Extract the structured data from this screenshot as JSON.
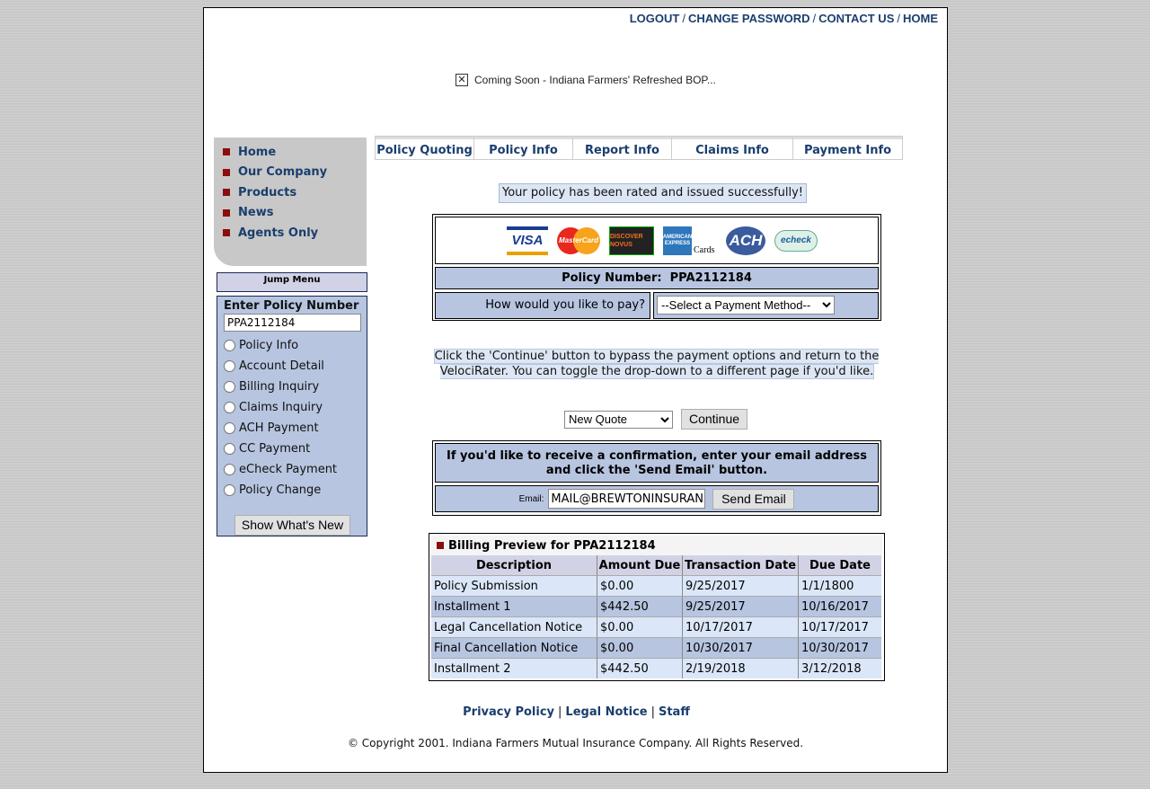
{
  "header": {
    "links": [
      "LOGOUT",
      "CHANGE PASSWORD",
      "CONTACT US",
      "HOME"
    ],
    "banner_text": "Coming Soon - Indiana Farmers' Refreshed BOP..."
  },
  "sidebar": {
    "items": [
      "Home",
      "Our Company",
      "Products",
      "News",
      "Agents Only"
    ],
    "jump_menu": "Jump Menu",
    "policy_header": "Enter Policy Number",
    "policy_value": "PPA2112184",
    "options": [
      "Policy Info",
      "Account Detail",
      "Billing Inquiry",
      "Claims Inquiry",
      "ACH Payment",
      "CC Payment",
      "eCheck Payment",
      "Policy Change"
    ],
    "show_new_label": "Show What's New"
  },
  "tabs": [
    "Policy Quoting",
    "Policy Info",
    "Report Info",
    "Claims Info",
    "Payment Info"
  ],
  "main": {
    "success_msg": "Your policy has been rated and issued successfully!",
    "cards": [
      "VISA",
      "MasterCard",
      "DISCOVER NOVUS",
      "AMERICAN EXPRESS",
      "Cards",
      "ACH",
      "echeck"
    ],
    "policy_label": "Policy Number:",
    "policy_number": "PPA2112184",
    "pay_question": "How would you like to pay?",
    "pay_select": "--Select a Payment Method--",
    "continue_note": "Click the 'Continue' button to bypass the payment options and return to the VelociRater.  You can toggle the drop-down to a different page if you'd like.",
    "quote_select": "New Quote",
    "continue_label": "Continue",
    "email_prompt": "If you'd like to receive a confirmation, enter your email address and click the 'Send Email' button.",
    "email_label": "Email:",
    "email_value": "MAIL@BREWTONINSURAN",
    "send_label": "Send Email"
  },
  "billing": {
    "title": "Billing Preview for PPA2112184",
    "columns": [
      "Description",
      "Amount Due",
      "Transaction Date",
      "Due Date"
    ],
    "rows": [
      [
        "Policy Submission",
        "$0.00",
        "9/25/2017",
        "1/1/1800"
      ],
      [
        "Installment 1",
        "$442.50",
        "9/25/2017",
        "10/16/2017"
      ],
      [
        "Legal Cancellation Notice",
        "$0.00",
        "10/17/2017",
        "10/17/2017"
      ],
      [
        "Final Cancellation Notice",
        "$0.00",
        "10/30/2017",
        "10/30/2017"
      ],
      [
        "Installment 2",
        "$442.50",
        "2/19/2018",
        "3/12/2018"
      ]
    ]
  },
  "footer": {
    "links": [
      "Privacy Policy",
      "Legal Notice",
      "Staff"
    ],
    "copyright": "© Copyright 2001. Indiana Farmers Mutual Insurance Company. All Rights Reserved."
  }
}
